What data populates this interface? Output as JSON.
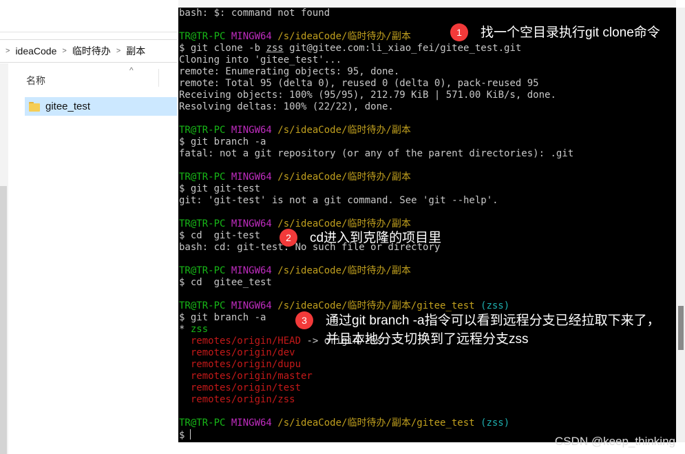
{
  "explorer": {
    "breadcrumbs": [
      "ideaCode",
      "临时待办",
      "副本"
    ],
    "separator": ">",
    "column_header": "名称",
    "sort_indicator": "^",
    "items": [
      {
        "name": "gitee_test",
        "icon": "folder-icon",
        "selected": true
      }
    ]
  },
  "terminal": {
    "lines": [
      [
        {
          "t": "bash: $: command not found",
          "c": "gray"
        }
      ],
      [],
      [
        {
          "t": "TR@TR-PC ",
          "c": "green"
        },
        {
          "t": "MINGW64 ",
          "c": "magenta"
        },
        {
          "t": "/s/ideaCode/临时待办/副本",
          "c": "yellow"
        }
      ],
      [
        {
          "t": "$ git clone -b ",
          "c": "gray"
        },
        {
          "t": "zss",
          "c": "gray",
          "u": true
        },
        {
          "t": " git@gitee.com:li_xiao_fei/gitee_test.git",
          "c": "gray"
        }
      ],
      [
        {
          "t": "Cloning into 'gitee_test'...",
          "c": "gray"
        }
      ],
      [
        {
          "t": "remote: Enumerating objects: 95, done.",
          "c": "gray"
        }
      ],
      [
        {
          "t": "remote: Total 95 (delta 0), reused 0 (delta 0), pack-reused 95",
          "c": "gray"
        }
      ],
      [
        {
          "t": "Receiving objects: 100% (95/95), 212.79 KiB | 571.00 KiB/s, done.",
          "c": "gray"
        }
      ],
      [
        {
          "t": "Resolving deltas: 100% (22/22), done.",
          "c": "gray"
        }
      ],
      [],
      [
        {
          "t": "TR@TR-PC ",
          "c": "green"
        },
        {
          "t": "MINGW64 ",
          "c": "magenta"
        },
        {
          "t": "/s/ideaCode/临时待办/副本",
          "c": "yellow"
        }
      ],
      [
        {
          "t": "$ git branch -a",
          "c": "gray"
        }
      ],
      [
        {
          "t": "fatal: not a git repository (or any of the parent directories): .git",
          "c": "gray"
        }
      ],
      [],
      [
        {
          "t": "TR@TR-PC ",
          "c": "green"
        },
        {
          "t": "MINGW64 ",
          "c": "magenta"
        },
        {
          "t": "/s/ideaCode/临时待办/副本",
          "c": "yellow"
        }
      ],
      [
        {
          "t": "$ git git-test",
          "c": "gray"
        }
      ],
      [
        {
          "t": "git: 'git-test' is not a git command. See 'git --help'.",
          "c": "gray"
        }
      ],
      [],
      [
        {
          "t": "TR@TR-PC ",
          "c": "green"
        },
        {
          "t": "MINGW64 ",
          "c": "magenta"
        },
        {
          "t": "/s/ideaCode/临时待办/副本",
          "c": "yellow"
        }
      ],
      [
        {
          "t": "$ cd  git-test",
          "c": "gray"
        }
      ],
      [
        {
          "t": "bash: cd: git-test: No such file or directory",
          "c": "gray"
        }
      ],
      [],
      [
        {
          "t": "TR@TR-PC ",
          "c": "green"
        },
        {
          "t": "MINGW64 ",
          "c": "magenta"
        },
        {
          "t": "/s/ideaCode/临时待办/副本",
          "c": "yellow"
        }
      ],
      [
        {
          "t": "$ cd  gitee_test",
          "c": "gray"
        }
      ],
      [],
      [
        {
          "t": "TR@TR-PC ",
          "c": "green"
        },
        {
          "t": "MINGW64 ",
          "c": "magenta"
        },
        {
          "t": "/s/ideaCode/临时待办/副本/gitee_test ",
          "c": "yellow"
        },
        {
          "t": "(zss)",
          "c": "cyan"
        }
      ],
      [
        {
          "t": "$ git branch -a",
          "c": "gray"
        }
      ],
      [
        {
          "t": "* ",
          "c": "gray"
        },
        {
          "t": "zss",
          "c": "green"
        }
      ],
      [
        {
          "t": "  remotes/origin/HEAD",
          "c": "red"
        },
        {
          "t": " -> origin/zss",
          "c": "gray"
        }
      ],
      [
        {
          "t": "  remotes/origin/dev",
          "c": "red"
        }
      ],
      [
        {
          "t": "  remotes/origin/dupu",
          "c": "red"
        }
      ],
      [
        {
          "t": "  remotes/origin/master",
          "c": "red"
        }
      ],
      [
        {
          "t": "  remotes/origin/test",
          "c": "red"
        }
      ],
      [
        {
          "t": "  remotes/origin/zss",
          "c": "red"
        }
      ],
      [],
      [
        {
          "t": "TR@TR-PC ",
          "c": "green"
        },
        {
          "t": "MINGW64 ",
          "c": "magenta"
        },
        {
          "t": "/s/ideaCode/临时待办/副本/gitee_test ",
          "c": "yellow"
        },
        {
          "t": "(zss)",
          "c": "cyan"
        }
      ],
      [
        {
          "t": "$",
          "c": "gray"
        }
      ]
    ],
    "cursor_line": 36
  },
  "annotations": [
    {
      "num": "1",
      "text": "找一个空目录执行git clone命令"
    },
    {
      "num": "2",
      "text": "cd进入到克隆的项目里"
    },
    {
      "num": "3",
      "text": "通过git branch -a指令可以看到远程分支已经拉取下来了，并且本地分支切换到了远程分支zss"
    }
  ],
  "colors": {
    "badge": "#f23a3a",
    "prompt_user": "#17b817",
    "prompt_shell": "#bf2cbf",
    "prompt_path": "#c1a01e",
    "branch": "#1eb0b0",
    "remote_branch": "#c41919"
  },
  "watermark": "CSDN @keep_thinking"
}
